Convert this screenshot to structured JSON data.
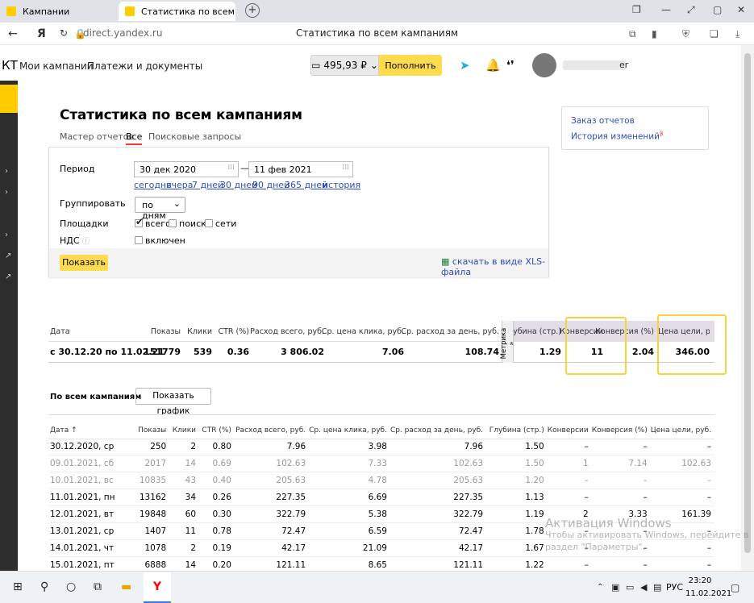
{
  "browser": {
    "tabs": [
      {
        "title": "Кампании"
      },
      {
        "title": "Статистика по всем ка"
      }
    ],
    "url": "direct.yandex.ru",
    "page_title": "Статистика по всем кампаниям",
    "yandex_button": "Я"
  },
  "header": {
    "logo": "КТ",
    "nav": [
      "Мои кампании",
      "Платежи и документы"
    ],
    "balance": "495,93 ₽",
    "topup_label": "Пополнить",
    "user_suffix": "er"
  },
  "page": {
    "title": "Статистика по всем кампаниям",
    "subtabs": [
      "Мастер отчетов",
      "Все",
      "Поисковые запросы"
    ],
    "side_links": [
      "Заказ отчетов",
      "История изменений"
    ],
    "side_link_badge": "β"
  },
  "filter": {
    "period_label": "Период",
    "date_from": "30 дек 2020",
    "date_dash": "—",
    "date_to": "11 фев 2021",
    "quick_ranges": [
      "сегодня",
      "вчера",
      "7 дней",
      "30 дней",
      "90 дней",
      "365 дней",
      "история"
    ],
    "group_label": "Группировать",
    "group_value": "по дням",
    "platforms_label": "Площадки",
    "platform_options": [
      {
        "label": "всего",
        "checked": true
      },
      {
        "label": "поиск",
        "checked": false
      },
      {
        "label": "сети",
        "checked": false
      }
    ],
    "vat_label": "НДС",
    "vat_option": {
      "label": "включен",
      "checked": false
    },
    "show_button": "Показать",
    "xls_link": "скачать в виде XLS-файла"
  },
  "summary": {
    "headers": [
      "Дата",
      "Показы",
      "Клики",
      "CTR (%)",
      "Расход всего, руб.",
      "Ср. цена клика, руб.",
      "Ср. расход за день, руб.",
      "Глубина (стр.)",
      "Конверсии",
      "Конверсия (%)",
      "Цена цели, руб."
    ],
    "metrika_label": "Метрика »",
    "row": [
      "с 30.12.20 по 11.02.21",
      "151779",
      "539",
      "0.36",
      "3 806.02",
      "7.06",
      "108.74",
      "1.29",
      "11",
      "2.04",
      "346.00"
    ]
  },
  "campaigns": {
    "title": "По всем кампаниям",
    "graph_button": "Показать график",
    "headers": [
      "Дата ↑",
      "Показы",
      "Клики",
      "CTR (%)",
      "Расход всего, руб.",
      "Ср. цена клика, руб.",
      "Ср. расход за день, руб.",
      "Глубина (стр.)",
      "Конверсии",
      "Конверсия (%)",
      "Цена цели, руб."
    ],
    "rows": [
      {
        "grey": false,
        "cells": [
          "30.12.2020, ср",
          "250",
          "2",
          "0.80",
          "7.96",
          "3.98",
          "7.96",
          "1.50",
          "–",
          "–",
          "–"
        ]
      },
      {
        "grey": true,
        "cells": [
          "09.01.2021, сб",
          "2017",
          "14",
          "0.69",
          "102.63",
          "7.33",
          "102.63",
          "1.50",
          "1",
          "7.14",
          "102.63"
        ]
      },
      {
        "grey": true,
        "cells": [
          "10.01.2021, вс",
          "10835",
          "43",
          "0.40",
          "205.63",
          "4.78",
          "205.63",
          "1.20",
          "–",
          "–",
          "–"
        ]
      },
      {
        "grey": false,
        "cells": [
          "11.01.2021, пн",
          "13162",
          "34",
          "0.26",
          "227.35",
          "6.69",
          "227.35",
          "1.13",
          "–",
          "–",
          "–"
        ]
      },
      {
        "grey": false,
        "cells": [
          "12.01.2021, вт",
          "19848",
          "60",
          "0.30",
          "322.79",
          "5.38",
          "322.79",
          "1.19",
          "2",
          "3.33",
          "161.39"
        ]
      },
      {
        "grey": false,
        "cells": [
          "13.01.2021, ср",
          "1407",
          "11",
          "0.78",
          "72.47",
          "6.59",
          "72.47",
          "1.78",
          "–",
          "–",
          "–"
        ]
      },
      {
        "grey": false,
        "cells": [
          "14.01.2021, чт",
          "1078",
          "2",
          "0.19",
          "42.17",
          "21.09",
          "42.17",
          "1.67",
          "–",
          "–",
          "–"
        ]
      },
      {
        "grey": false,
        "cells": [
          "15.01.2021, пт",
          "6888",
          "14",
          "0.20",
          "121.11",
          "8.65",
          "121.11",
          "1.22",
          "–",
          "–",
          "–"
        ]
      }
    ]
  },
  "watermark": {
    "line1": "Активация Windows",
    "line2": "Чтобы активировать Windows, перейдите в",
    "line3": "раздел \"Параметры\"."
  },
  "taskbar": {
    "lang": "РУС",
    "time": "23:20",
    "date": "11.02.2021"
  },
  "colors": {
    "accent_yellow": "#ffdb4d",
    "link_blue": "#2d4ec0",
    "highlight": "#f5d43c",
    "metrika_bg": "#e2dde7"
  }
}
